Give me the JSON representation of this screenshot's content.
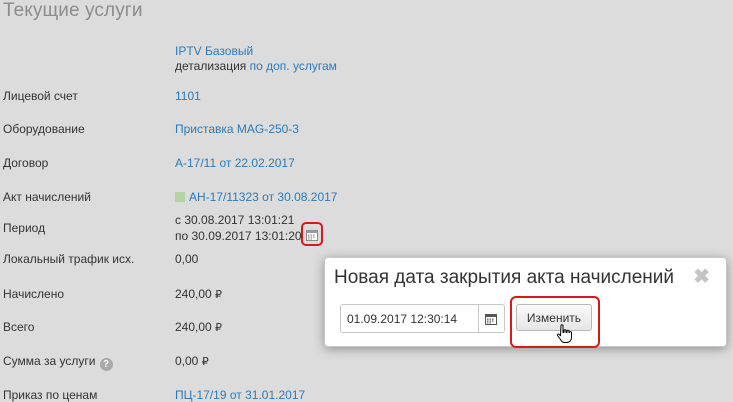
{
  "page": {
    "title": "Текущие услуги"
  },
  "service": {
    "name": "IPTV Базовый",
    "detail_prefix": "детализация",
    "detail_link": "по доп. услугам"
  },
  "rows": {
    "account": {
      "label": "Лицевой счет",
      "value": "1101"
    },
    "equipment": {
      "label": "Оборудование",
      "value": "Приставка MAG-250-3"
    },
    "contract": {
      "label": "Договор",
      "value": "А-17/11 от 22.02.2017"
    },
    "act": {
      "label": "Акт начислений",
      "value": "АН-17/11323 от 30.08.2017",
      "status_color": "#b7d3a3"
    },
    "period": {
      "label": "Период",
      "from": "с 30.08.2017 13:01:21",
      "to": "по 30.09.2017 13:01:20"
    },
    "local_traffic": {
      "label": "Локальный трафик исх.",
      "value": "0,00"
    },
    "charged": {
      "label": "Начислено",
      "value": "240,00",
      "currency": "₽"
    },
    "total": {
      "label": "Всего",
      "value": "240,00",
      "currency": "₽"
    },
    "services_sum": {
      "label": "Сумма за услуги",
      "help": "?",
      "value": "0,00",
      "currency": "₽"
    },
    "price_order": {
      "label": "Приказ по ценам",
      "value": "ПЦ-17/19 от 31.01.2017"
    }
  },
  "popup": {
    "title": "Новая дата закрытия акта начислений",
    "close": "✖",
    "date_value": "01.09.2017 12:30:14",
    "change_button": "Изменить"
  },
  "colors": {
    "highlight": "#d6191c",
    "link": "#2a7bbd",
    "background": "#dcdcdc"
  }
}
